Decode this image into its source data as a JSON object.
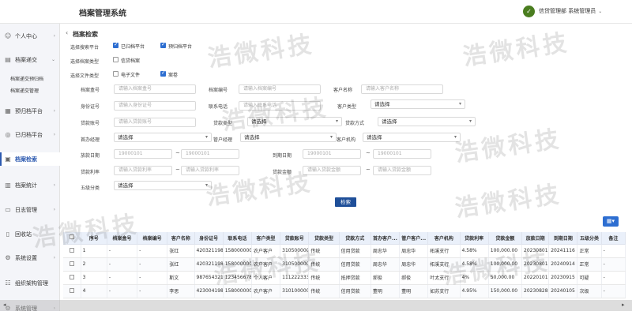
{
  "app": {
    "title": "档案管理系统",
    "logo_glyph": "✓",
    "user": "信贷管理部 系统管理员",
    "caret": "⌄"
  },
  "sidebar": {
    "items": [
      {
        "label": "个人中心",
        "icon": "person-icon",
        "glyph": "☺"
      },
      {
        "label": "档案递交",
        "icon": "file-icon",
        "glyph": "▤"
      },
      {
        "label": "预归档平台",
        "icon": "archive-icon",
        "glyph": "▦"
      },
      {
        "label": "已归档平台",
        "icon": "check-circle-icon",
        "glyph": "◎"
      },
      {
        "label": "档案检索",
        "icon": "search-doc-icon",
        "glyph": "▣"
      },
      {
        "label": "档案统计",
        "icon": "chart-icon",
        "glyph": "▥"
      },
      {
        "label": "日志管理",
        "icon": "log-icon",
        "glyph": "▭"
      },
      {
        "label": "回收站",
        "icon": "trash-icon",
        "glyph": "▯"
      },
      {
        "label": "系统设置",
        "icon": "gear-icon",
        "glyph": "⚙"
      },
      {
        "label": "组织架构管理",
        "icon": "org-icon",
        "glyph": "☷"
      },
      {
        "label": "系统管理",
        "icon": "admin-icon",
        "glyph": "⚙"
      }
    ],
    "subitems": [
      "档案递交预归档",
      "档案递交管理"
    ]
  },
  "main": {
    "title": "档案检索",
    "collapse_glyph": "‹"
  },
  "filters": {
    "platform_label": "选择搜索平台",
    "platform_opts": [
      {
        "label": "已归档平台",
        "checked": true
      },
      {
        "label": "预归档平台",
        "checked": true
      }
    ],
    "archtype_label": "选择档案类型",
    "archtype_opts": [
      {
        "label": "信贷档案",
        "checked": false
      }
    ],
    "filetype_label": "选择文件类型",
    "filetype_opts": [
      {
        "label": "电子文件",
        "checked": false
      },
      {
        "label": "案卷",
        "checked": true
      }
    ],
    "fields": {
      "boxno": {
        "label": "档案盒号",
        "placeholder": "请输入档案盒号"
      },
      "archno": {
        "label": "档案编号",
        "placeholder": "请输入档案编号"
      },
      "custname": {
        "label": "客户名称",
        "placeholder": "请输入客户名称"
      },
      "idcard": {
        "label": "身份证号",
        "placeholder": "请输入身份证号"
      },
      "phone": {
        "label": "联系电话",
        "placeholder": "请输入联系电话"
      },
      "custtype": {
        "label": "客户类型",
        "value": "请选择"
      },
      "loanacct": {
        "label": "贷款账号",
        "placeholder": "请输入贷款账号"
      },
      "loantype": {
        "label": "贷款类型",
        "value": "请选择"
      },
      "loanway": {
        "label": "贷款方式",
        "value": "请选择"
      },
      "manager": {
        "label": "首办经理",
        "value": "请选择"
      },
      "mgr2": {
        "label": "管户经理",
        "value": "请选择"
      },
      "org": {
        "label": "客户机构",
        "value": "请选择"
      },
      "loandate": {
        "label": "放款日期",
        "from": "19000101",
        "to": "19000101"
      },
      "duedate": {
        "label": "到期日期",
        "from": "19000101",
        "to": "19000101"
      },
      "rate": {
        "label": "贷款利率",
        "from": "请输入贷款利率",
        "to": "请输入贷款利率"
      },
      "amount": {
        "label": "贷款金额",
        "from": "请输入贷款金额",
        "to": "请输入贷款金额"
      },
      "grade": {
        "label": "五级分类",
        "value": "请选择"
      }
    },
    "tilde": "~",
    "search_btn": "检索",
    "grid_btn": "▦▾"
  },
  "table": {
    "headers": [
      "",
      "序号",
      "档案盒号",
      "档案编号",
      "客户名称",
      "身份证号",
      "联系电话",
      "客户类型",
      "贷款账号",
      "贷款类型",
      "贷款方式",
      "首办客户...",
      "管户客户...",
      "客户机构",
      "贷款利率",
      "贷款金额",
      "放款日期",
      "到期日期",
      "五级分类",
      "备注"
    ],
    "rows": [
      [
        "",
        "1",
        "-",
        "-",
        "张红",
        "420321198",
        "158000000",
        "农户客户",
        "310500000",
        "传统",
        "信用贷款",
        "周忠华",
        "周忠华",
        "柘溪支行",
        "4.58%",
        "100,000.00",
        "20230801",
        "20241116",
        "正常",
        "-"
      ],
      [
        "",
        "2",
        "-",
        "-",
        "张红",
        "420321198",
        "158000000",
        "农户客户",
        "310500000",
        "传统",
        "信用贷款",
        "周忠华",
        "周忠华",
        "柘溪支行",
        "4.58%",
        "100,000.00",
        "20230801",
        "20240914",
        "正常",
        "-"
      ],
      [
        "",
        "3",
        "-",
        "-",
        "斯文",
        "987654321",
        "123456678",
        "个人客户",
        "111222333",
        "传统",
        "抵押贷款",
        "郝俊",
        "郝俊",
        "叶太支行",
        "4%",
        "50,000.00",
        "20220101",
        "20230915",
        "可疑",
        "-"
      ],
      [
        "",
        "4",
        "-",
        "-",
        "李思",
        "423004198",
        "158000000",
        "农户客户",
        "310100000",
        "传统",
        "信用贷款",
        "董明",
        "董明",
        "如苏支行",
        "4.95%",
        "150,000.00",
        "20230828",
        "20240105",
        "次级",
        "-"
      ]
    ]
  },
  "scroll": {
    "left": "◂",
    "right": "▸"
  },
  "watermark": "浩微科技"
}
